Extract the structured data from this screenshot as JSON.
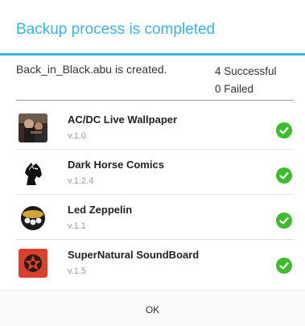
{
  "dialog": {
    "title": "Backup process is completed",
    "message": "Back_in_Black.abu is created.",
    "successful": "4 Successful",
    "failed": "0 Failed"
  },
  "apps": [
    {
      "name": "AC/DC Live Wallpaper",
      "version": "v.1.0",
      "icon": "band-photo-icon"
    },
    {
      "name": "Dark Horse Comics",
      "version": "v.1.2.4",
      "icon": "horse-head-icon"
    },
    {
      "name": "Led Zeppelin",
      "version": "v.1.1",
      "icon": "zeppelin-logo-icon"
    },
    {
      "name": "SuperNatural SoundBoard",
      "version": "v.1.5",
      "icon": "pentagram-icon"
    }
  ],
  "footer": {
    "ok_label": "OK"
  },
  "colors": {
    "accent": "#33b5e5",
    "success": "#3dbd2e"
  }
}
